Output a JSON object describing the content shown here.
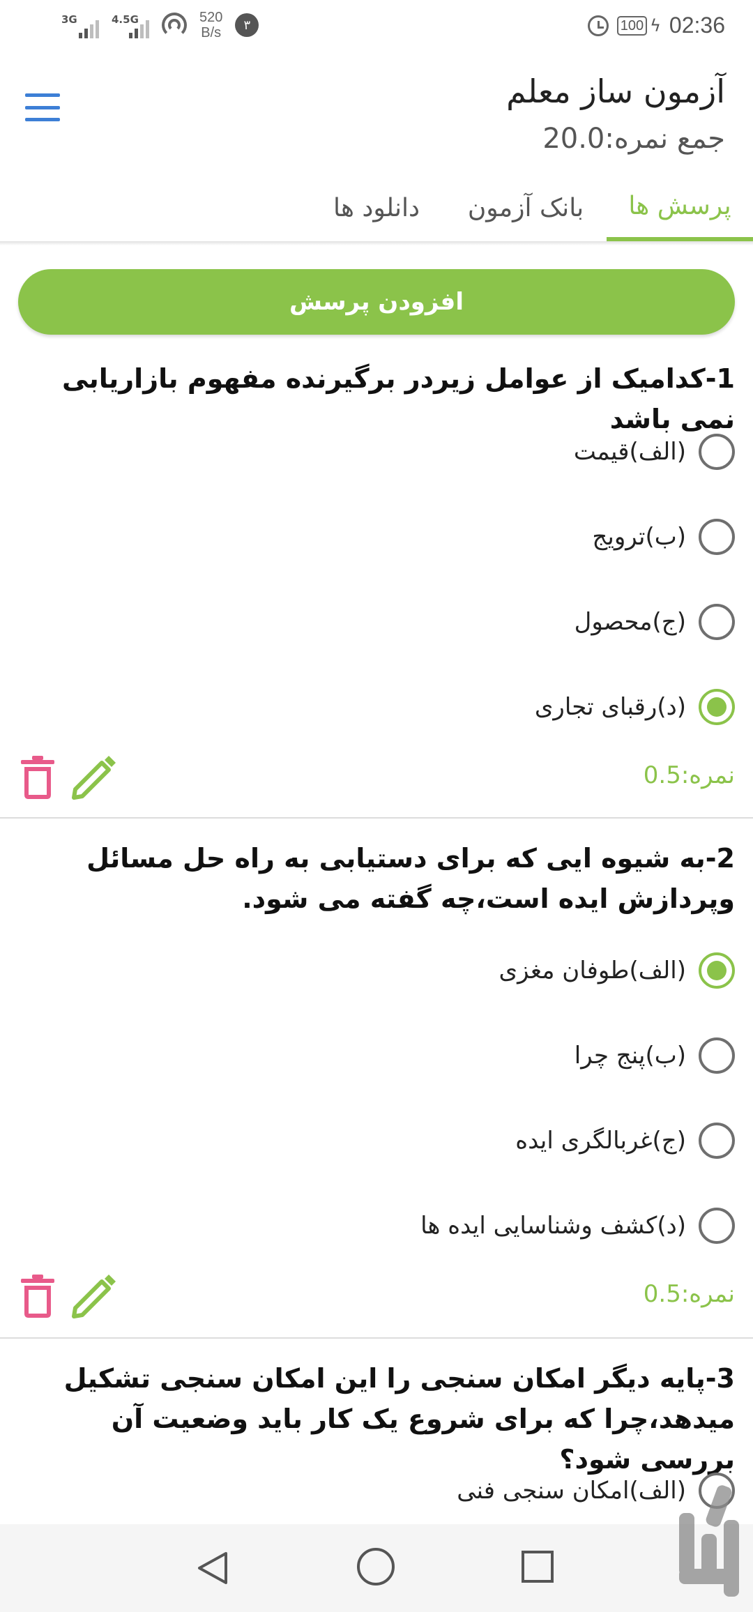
{
  "status_bar": {
    "signal1": "3G",
    "signal2": "4.5G",
    "speed_value": "520",
    "speed_unit": "B/s",
    "notification_count": "۳",
    "battery": "100",
    "time": "02:36"
  },
  "app": {
    "title": "آزمون ساز معلم",
    "total_score": "جمع نمره:20.0"
  },
  "tabs": [
    {
      "label": "پرسش ها",
      "active": true
    },
    {
      "label": "بانک آزمون",
      "active": false
    },
    {
      "label": "دانلود ها",
      "active": false
    }
  ],
  "add_question_label": "افزودن پرسش",
  "accent_color": "#8bc34a",
  "delete_color": "#e85a8a",
  "questions": [
    {
      "text": "1-کدامیک از عوامل زیردر برگیرنده مفهوم بازاریابی نمی باشد",
      "options": [
        {
          "label": "(الف)قیمت",
          "selected": false
        },
        {
          "label": "(ب)ترویج",
          "selected": false
        },
        {
          "label": "(ج)محصول",
          "selected": false
        },
        {
          "label": "(د)رقبای تجاری",
          "selected": true
        }
      ],
      "score": "نمره:0.5"
    },
    {
      "text": "2-به شیوه ایی که برای دستیابی به راه حل مسائل وپردازش ایده است،چه گفته می شود.",
      "options": [
        {
          "label": "(الف)طوفان مغزی",
          "selected": true
        },
        {
          "label": "(ب)پنج چرا",
          "selected": false
        },
        {
          "label": "(ج)غربالگری ایده",
          "selected": false
        },
        {
          "label": "(د)کشف وشناسایی ایده ها",
          "selected": false
        }
      ],
      "score": "نمره:0.5"
    },
    {
      "text": "3-پایه دیگر امکان سنجی را این امکان سنجی تشکیل میدهد،چرا که برای شروع یک کار باید وضعیت آن بررسی شود؟",
      "options": [
        {
          "label": "(الف)امکان سنجی فنی",
          "selected": false
        }
      ]
    }
  ],
  "nav_bar": {
    "back": "back-icon",
    "home": "home-icon",
    "recents": "recents-icon"
  }
}
